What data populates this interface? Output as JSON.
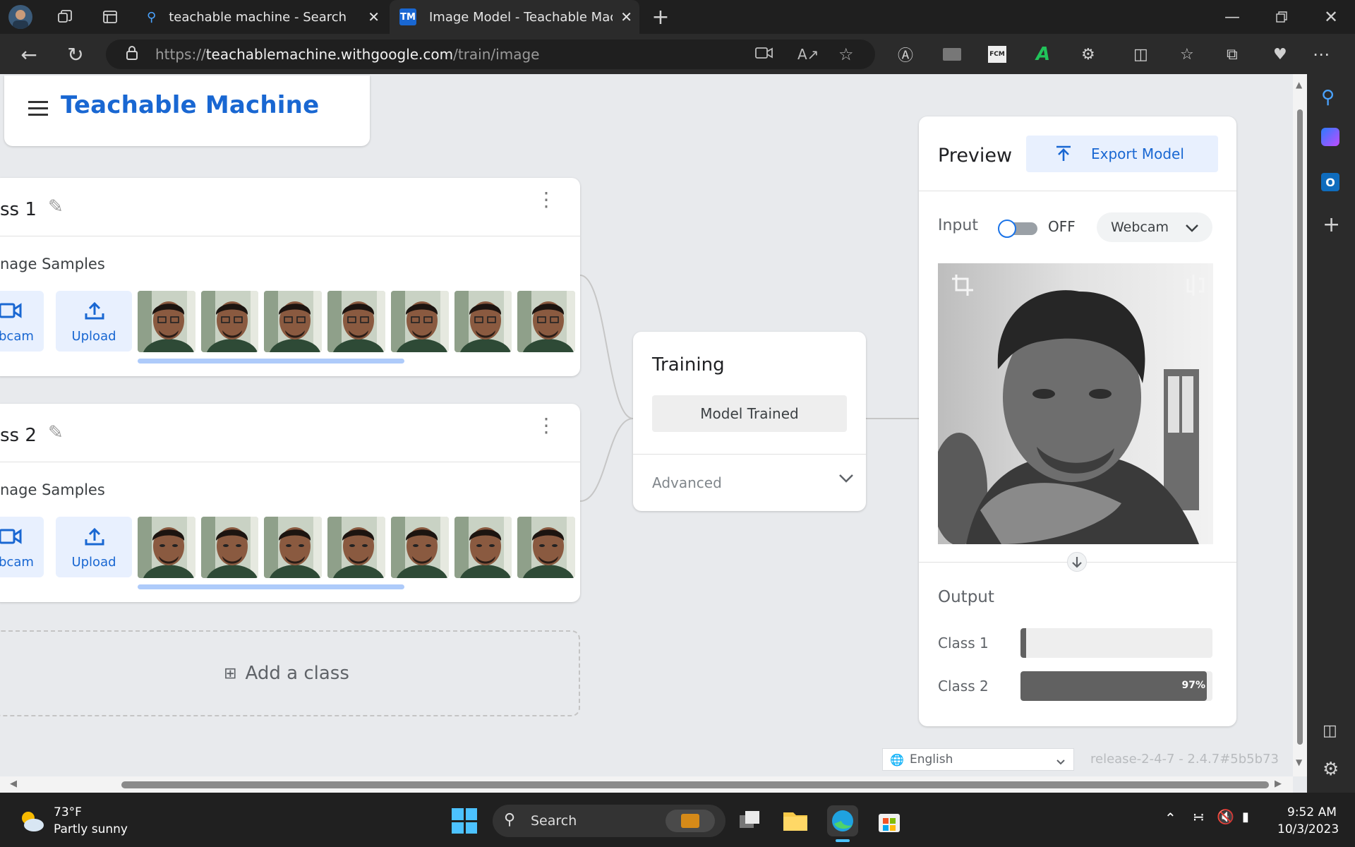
{
  "browser": {
    "tabs": [
      {
        "title": "teachable machine - Search",
        "icon": "search-icon"
      },
      {
        "title": "Image Model - Teachable Machir",
        "icon": "tm-favicon"
      }
    ],
    "url": {
      "scheme": "https://",
      "host": "teachablemachine.withgoogle.com",
      "path": "/train/image"
    }
  },
  "app": {
    "title": "Teachable Machine",
    "classes": [
      {
        "name": "ss 1",
        "samples_label": "nage Samples",
        "webcam_label": "bcam",
        "upload_label": "Upload",
        "sample_count": 7
      },
      {
        "name": "ss 2",
        "samples_label": "nage Samples",
        "webcam_label": "bcam",
        "upload_label": "Upload",
        "sample_count": 7
      }
    ],
    "add_class_label": "Add a class",
    "training": {
      "title": "Training",
      "status_button": "Model Trained",
      "advanced_label": "Advanced"
    },
    "preview": {
      "title": "Preview",
      "export_label": "Export Model",
      "input_label": "Input",
      "toggle_state": "OFF",
      "source_select": "Webcam",
      "output_label": "Output",
      "outputs": [
        {
          "label": "Class 1",
          "value": 0.03,
          "text": ""
        },
        {
          "label": "Class 2",
          "value": 0.97,
          "text": "97%"
        }
      ]
    },
    "language_select": "English",
    "release": "release-2-4-7 - 2.4.7#5b5b73"
  },
  "taskbar": {
    "weather_temp": "73°F",
    "weather_desc": "Partly sunny",
    "search_placeholder": "Search",
    "time": "9:52 AM",
    "date": "10/3/2023"
  },
  "colors": {
    "brand_blue": "#1967d2",
    "light_blue": "#e8f0fe",
    "output_bar": "#616161"
  }
}
